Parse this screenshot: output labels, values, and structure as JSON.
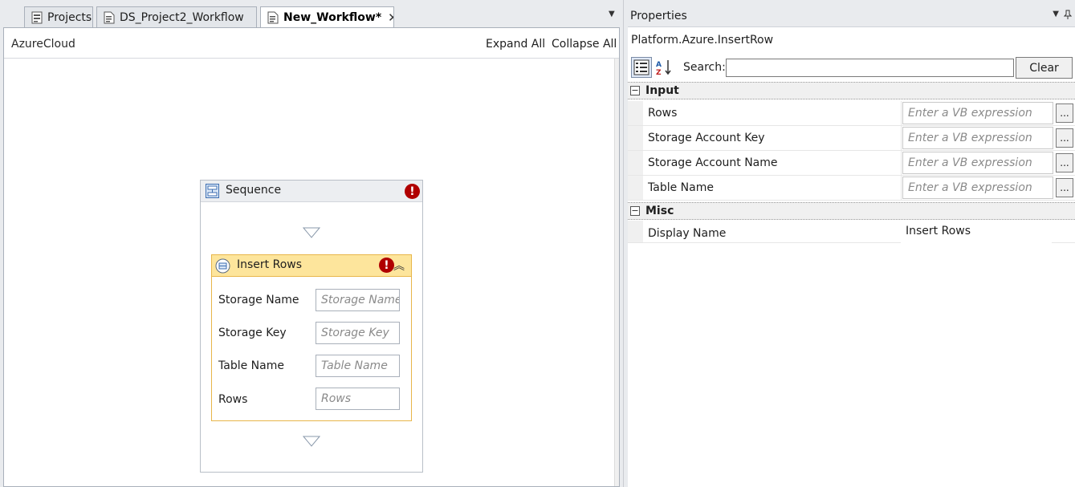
{
  "tabs": [
    {
      "label": "Projects",
      "active": false
    },
    {
      "label": "DS_Project2_Workflow",
      "active": false
    },
    {
      "label": "New_Workflow*",
      "active": true
    }
  ],
  "designer": {
    "breadcrumb": "AzureCloud",
    "expand_all": "Expand All",
    "collapse_all": "Collapse All",
    "sequence": {
      "title": "Sequence",
      "error_glyph": "!",
      "activity": {
        "title": "Insert Rows",
        "error_glyph": "!",
        "fields": [
          {
            "label": "Storage Name",
            "placeholder": "Storage Name"
          },
          {
            "label": "Storage Key",
            "placeholder": "Storage Key"
          },
          {
            "label": "Table Name",
            "placeholder": "Table Name"
          },
          {
            "label": "Rows",
            "placeholder": "Rows"
          }
        ]
      }
    }
  },
  "properties": {
    "title": "Properties",
    "type_name": "Platform.Azure.InsertRow",
    "search_label": "Search:",
    "clear_label": "Clear",
    "categories": [
      {
        "name": "Input",
        "props": [
          {
            "name": "Rows",
            "value": "Enter a VB expression"
          },
          {
            "name": "Storage Account Key",
            "value": "Enter a VB expression"
          },
          {
            "name": "Storage Account Name",
            "value": "Enter a VB expression"
          },
          {
            "name": "Table Name",
            "value": "Enter a VB expression"
          }
        ]
      },
      {
        "name": "Misc",
        "props": [
          {
            "name": "Display Name",
            "value": "Insert Rows"
          }
        ]
      }
    ],
    "ellipsis": "...",
    "collapse_glyph": "−"
  },
  "colors": {
    "error_red": "#b00000",
    "activity_header": "#fde59c",
    "activity_border": "#e8b64a"
  }
}
